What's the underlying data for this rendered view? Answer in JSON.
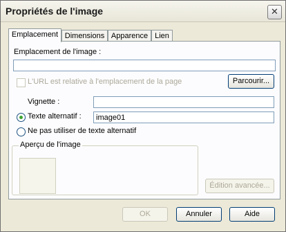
{
  "dialog": {
    "title": "Propriétés de l'image",
    "close_icon": "close-icon"
  },
  "tabs": [
    {
      "label": "Emplacement",
      "active": true
    },
    {
      "label": "Dimensions",
      "active": false
    },
    {
      "label": "Apparence",
      "active": false
    },
    {
      "label": "Lien",
      "active": false
    }
  ],
  "location": {
    "label": "Emplacement de l'image :",
    "value": "",
    "relative_url_label": "L'URL est relative à l'emplacement de la page",
    "relative_url_checked": false,
    "browse_button": "Parcourir..."
  },
  "thumbnail": {
    "label": "Vignette :",
    "value": ""
  },
  "alt_text": {
    "radio_label": "Texte alternatif :",
    "selected": true,
    "value": "image01",
    "no_alt_label": "Ne pas utiliser de texte alternatif"
  },
  "preview": {
    "legend": "Aperçu de l'image"
  },
  "advanced_button": "Édition avancée...",
  "footer": {
    "ok": "OK",
    "cancel": "Annuler",
    "help": "Aide"
  }
}
